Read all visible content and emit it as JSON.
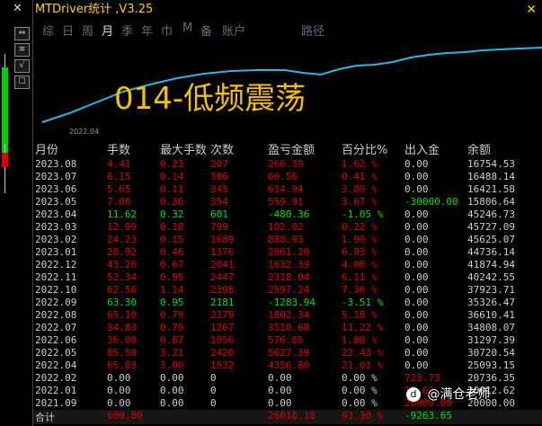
{
  "app": {
    "title": "MTDriver统计 ,V3.25",
    "close": "✕"
  },
  "leftbar": {
    "x": "✕",
    "buttons": [
      "⇔",
      "≡",
      "√",
      "☐"
    ]
  },
  "tabs": [
    "综",
    "日",
    "周",
    "月",
    "季",
    "年",
    "巾",
    "M",
    "备",
    "账户",
    "路径"
  ],
  "active_tab": "月",
  "chart": {
    "overlay_title": "014-低频震荡",
    "xlabel": "2022.04"
  },
  "columns": [
    "月份",
    "手数",
    "最大手数",
    "次数",
    "盈亏金额",
    "百分比%",
    "出入金",
    "余额"
  ],
  "rows": [
    [
      "2023.08",
      "4.41",
      "0.23",
      "207",
      "266.39",
      "1.62 %",
      "0.00",
      "16754.53"
    ],
    [
      "2023.07",
      "6.15",
      "0.14",
      "386",
      "66.56",
      "0.41 %",
      "0.00",
      "16488.14"
    ],
    [
      "2023.06",
      "5.65",
      "0.11",
      "345",
      "614.94",
      "3.89 %",
      "0.00",
      "16421.58"
    ],
    [
      "2023.05",
      "7.00",
      "0.30",
      "354",
      "559.91",
      "3.67 %",
      "-30000.00",
      "15806.64"
    ],
    [
      "2023.04",
      "11.62",
      "0.32",
      "601",
      "-480.36",
      "-1.05 %",
      "0.00",
      "45246.73"
    ],
    [
      "2023.03",
      "12.99",
      "0.18",
      "799",
      "102.02",
      "0.22 %",
      "0.00",
      "45727.09"
    ],
    [
      "2023.02",
      "24.23",
      "0.15",
      "1689",
      "888.93",
      "1.99 %",
      "0.00",
      "45625.07"
    ],
    [
      "2023.01",
      "20.92",
      "0.46",
      "1376",
      "2861.20",
      "6.83 %",
      "0.00",
      "44736.14"
    ],
    [
      "2022.12",
      "43.26",
      "0.67",
      "2041",
      "1632.39",
      "4.06 %",
      "0.00",
      "41874.94"
    ],
    [
      "2022.11",
      "52.34",
      "0.95",
      "2447",
      "2318.04",
      "6.11 %",
      "0.00",
      "40242.55"
    ],
    [
      "2022.10",
      "62.56",
      "1.14",
      "2398",
      "2597.24",
      "7.36 %",
      "0.00",
      "37923.71"
    ],
    [
      "2022.09",
      "63.30",
      "0.95",
      "2181",
      "-1283.94",
      "-3.51 %",
      "0.00",
      "35326.47"
    ],
    [
      "2022.08",
      "65.10",
      "0.79",
      "2179",
      "1802.34",
      "5.18 %",
      "0.00",
      "36610.41"
    ],
    [
      "2022.07",
      "34.83",
      "0.79",
      "1267",
      "3510.68",
      "11.22 %",
      "0.00",
      "34808.07"
    ],
    [
      "2022.06",
      "36.00",
      "0.87",
      "1056",
      "576.85",
      "1.88 %",
      "0.00",
      "31297.39"
    ],
    [
      "2022.05",
      "85.50",
      "3.21",
      "2420",
      "5627.39",
      "22.43 %",
      "0.00",
      "30720.54"
    ],
    [
      "2022.04",
      "65.03",
      "3.00",
      "1532",
      "4356.80",
      "21.01 %",
      "0.00",
      "25093.15"
    ],
    [
      "2022.02",
      "0.00",
      "0.00",
      "0",
      "0.00",
      "0.00 %",
      "723.73",
      "20736.35"
    ],
    [
      "2022.01",
      "0.00",
      "0.00",
      "0",
      "0.00",
      "0.00 %",
      "12.62",
      "20012.62"
    ],
    [
      "2021.09",
      "0.00",
      "0.00",
      "0",
      "0.00",
      "0.00 %",
      "20000.00",
      "20000.00"
    ]
  ],
  "row_colors": [
    "up",
    "up",
    "up",
    "up",
    "dn",
    "up",
    "up",
    "up",
    "up",
    "up",
    "up",
    "dn",
    "up",
    "up",
    "up",
    "up",
    "up",
    "neu",
    "neu",
    "neu"
  ],
  "deposit_colors": [
    "neu",
    "neu",
    "neu",
    "dn",
    "neu",
    "neu",
    "neu",
    "neu",
    "neu",
    "neu",
    "neu",
    "neu",
    "neu",
    "neu",
    "neu",
    "neu",
    "neu",
    "up",
    "up",
    "up"
  ],
  "total": {
    "label": "合计",
    "lots": "600.89",
    "profit": "26018.18",
    "pct": "93.30 %",
    "deposit": "-9263.65"
  },
  "watermark": "@满仓老师"
}
